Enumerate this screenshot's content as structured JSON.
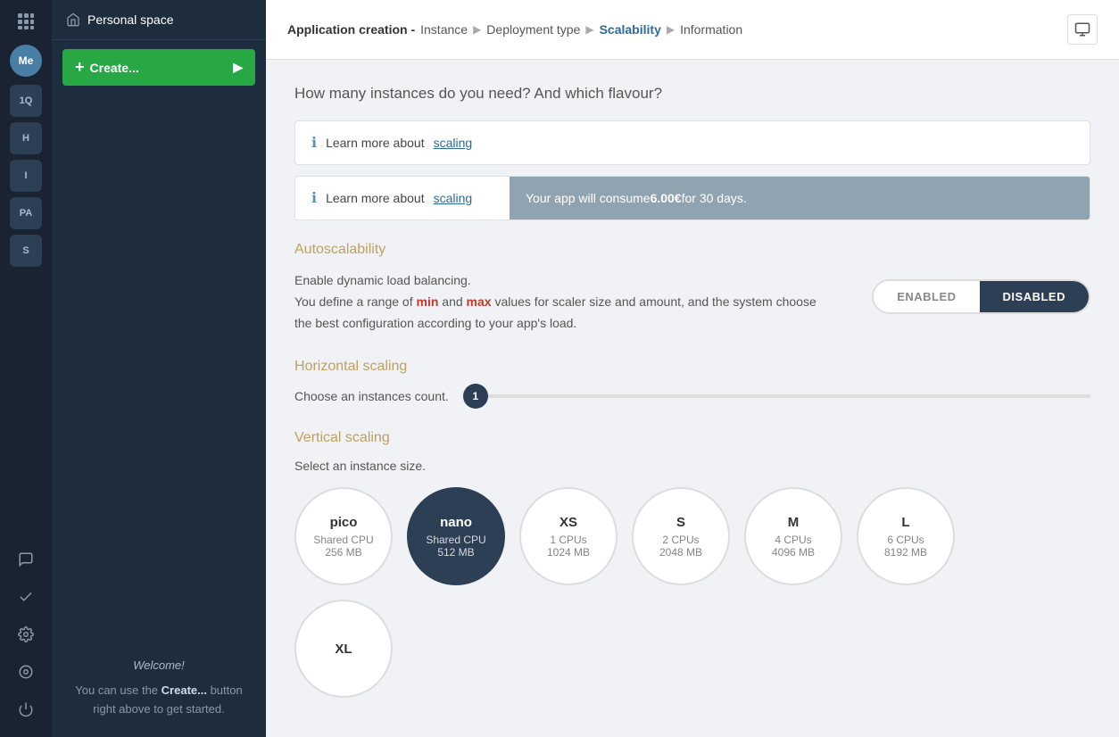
{
  "iconRail": {
    "spaces": [
      "1Q",
      "H",
      "I",
      "PA",
      "S"
    ]
  },
  "sidebar": {
    "personalSpace": "Personal space",
    "createLabel": "Create...",
    "welcomeTitle": "Welcome!",
    "welcomeText": "You can use the ",
    "welcomeButtonRef": "Create...",
    "welcomeTextEnd": " button right above to get started."
  },
  "topbar": {
    "appCreation": "Application creation -",
    "breadcrumbs": [
      {
        "label": "Instance",
        "active": false
      },
      {
        "label": "Deployment type",
        "active": false
      },
      {
        "label": "Scalability",
        "active": true
      },
      {
        "label": "Information",
        "active": false
      }
    ]
  },
  "main": {
    "pageQuestion": "How many instances do you need? And which flavour?",
    "infoBox1": {
      "prefix": "Learn more about ",
      "linkText": "scaling"
    },
    "infoBox2": {
      "prefix": "Learn more about ",
      "linkText": "scaling",
      "rightText": "Your app will consume ",
      "price": "6.00€",
      "suffix": " for 30 days."
    },
    "autoscalability": {
      "heading": "Autoscalability",
      "descLine1": "Enable dynamic load balancing.",
      "descLine2": "You define a range of ",
      "minText": "min",
      "andText": " and ",
      "maxText": "max",
      "descLine3": " values for scaler size and amount, and the system choose the best configuration according to your app's load.",
      "enabledLabel": "ENABLED",
      "disabledLabel": "DISABLED"
    },
    "horizontalScaling": {
      "heading": "Horizontal scaling",
      "chooseLabel": "Choose an instances count.",
      "sliderValue": "1"
    },
    "verticalScaling": {
      "heading": "Vertical scaling",
      "selectLabel": "Select an instance size.",
      "sizes": [
        {
          "name": "pico",
          "cpu": "Shared CPU",
          "ram": "256 MB",
          "selected": false
        },
        {
          "name": "nano",
          "cpu": "Shared CPU",
          "ram": "512 MB",
          "selected": true
        },
        {
          "name": "XS",
          "cpu": "1 CPUs",
          "ram": "1024 MB",
          "selected": false
        },
        {
          "name": "S",
          "cpu": "2 CPUs",
          "ram": "2048 MB",
          "selected": false
        },
        {
          "name": "M",
          "cpu": "4 CPUs",
          "ram": "4096 MB",
          "selected": false
        },
        {
          "name": "L",
          "cpu": "6 CPUs",
          "ram": "8192 MB",
          "selected": false
        }
      ],
      "xlName": "XL"
    }
  }
}
